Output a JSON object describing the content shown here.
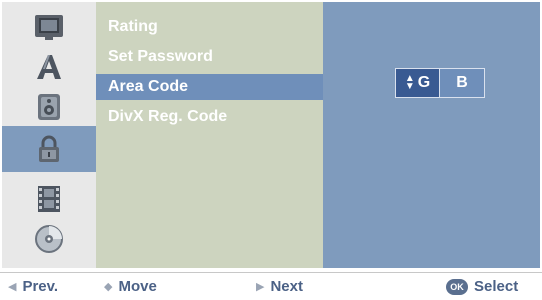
{
  "sidebar": {
    "icons": [
      {
        "name": "picture-icon",
        "selected": false
      },
      {
        "name": "language-icon",
        "selected": false
      },
      {
        "name": "audio-icon",
        "selected": false
      },
      {
        "name": "lock-icon",
        "selected": true
      },
      {
        "name": "film-icon",
        "selected": false
      },
      {
        "name": "disc-icon",
        "selected": false
      }
    ]
  },
  "menu": {
    "items": [
      {
        "label": "Rating"
      },
      {
        "label": "Set Password"
      },
      {
        "label": "Area Code"
      },
      {
        "label": "DivX Reg. Code"
      }
    ],
    "selected_index": 2
  },
  "area_code": {
    "letters": [
      "G",
      "B"
    ],
    "active_index": 0
  },
  "footer": {
    "prev_label": "Prev.",
    "move_label": "Move",
    "next_label": "Next",
    "ok_label": "OK",
    "select_label": "Select"
  },
  "colors": {
    "selected_bg": "#6f8fba",
    "value_panel": "#7f9bbd",
    "menu_panel": "#cdd4bf",
    "accent_text": "#4b6186"
  }
}
